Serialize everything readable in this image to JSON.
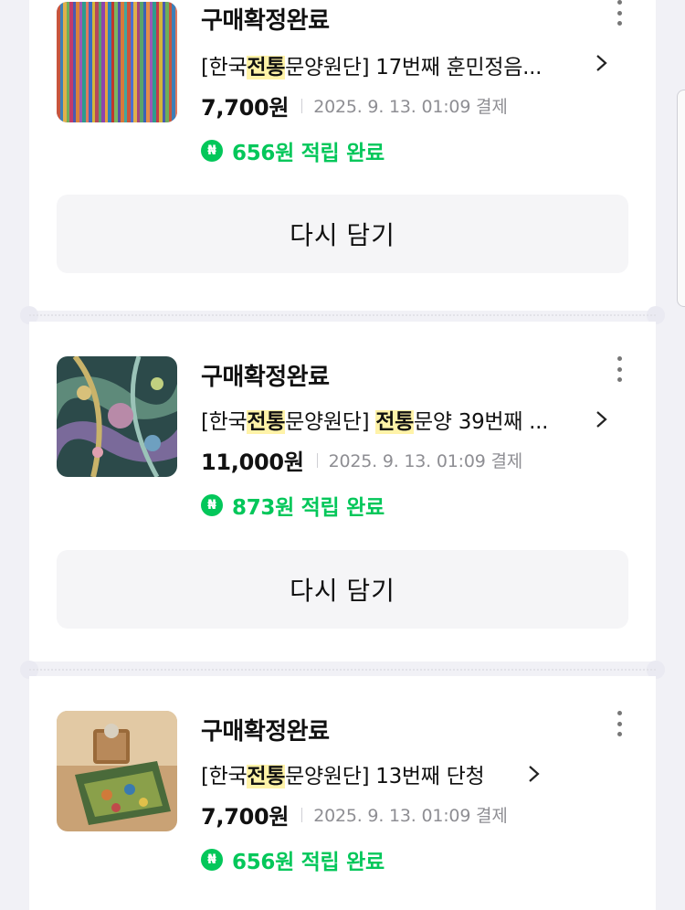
{
  "orders": [
    {
      "status": "구매확정완료",
      "title_prefix": "[한국",
      "title_hl1": "전통",
      "title_mid": "문양원단] 17번째 훈민정음...",
      "title_hl2": "",
      "title_tail": "",
      "price": "7,700원",
      "date": "2025. 9. 13. 01:09 결제",
      "points": "656원 적립 완료",
      "button": "다시 담기",
      "thumb": "striped-fabric"
    },
    {
      "status": "구매확정완료",
      "title_prefix": "[한국",
      "title_hl1": "전통",
      "title_mid": "문양원단] ",
      "title_hl2": "전통",
      "title_tail": "문양 39번째 ...",
      "price": "11,000원",
      "date": "2025. 9. 13. 01:09 결제",
      "points": "873원 적립 완료",
      "button": "다시 담기",
      "thumb": "patterned-silk"
    },
    {
      "status": "구매확정완료",
      "title_prefix": "[한국",
      "title_hl1": "전통",
      "title_mid": "문양원단] 13번째 단청",
      "title_hl2": "",
      "title_tail": "",
      "price": "7,700원",
      "date": "2025. 9. 13. 01:09 결제",
      "points": "656원 적립 완료",
      "button": "다시 담기",
      "thumb": "dancheong-cloth"
    }
  ],
  "point_icon_glyph": "₦",
  "colors": {
    "accent_green": "#03c75a",
    "highlight": "#fff3a8",
    "background": "#f1f1f6"
  }
}
